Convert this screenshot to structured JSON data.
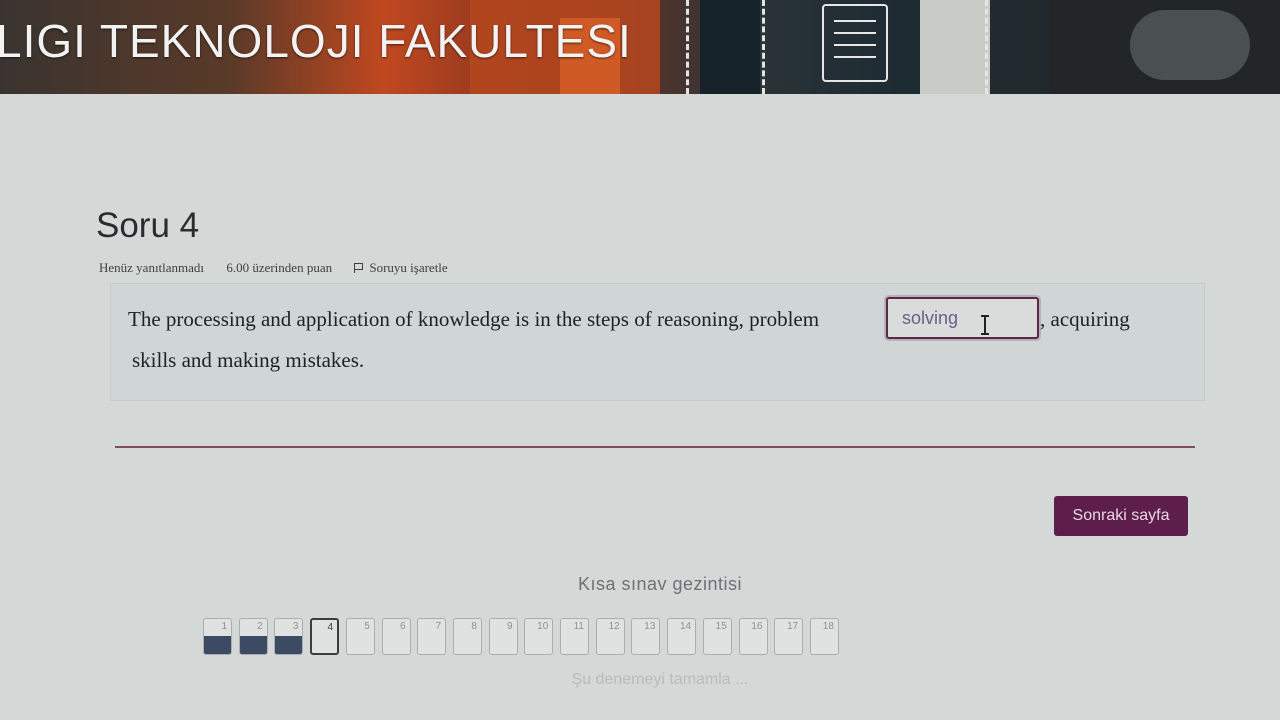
{
  "header": {
    "title": "LIGI TEKNOLOJI FAKULTESI"
  },
  "question": {
    "title": "Soru 4",
    "status": "Henüz yanıtlanmadı",
    "points": "6.00 üzerinden puan",
    "flag_label": "Soruyu işaretle",
    "text_before": "The processing and application of knowledge is in the steps of reasoning, problem",
    "answer_value": "solving",
    "text_after_line1": ", acquiring",
    "text_line2": "skills and making mistakes."
  },
  "actions": {
    "next_label": "Sonraki sayfa"
  },
  "quiz_nav": {
    "title": "Kısa sınav gezintisi",
    "buttons": [
      {
        "label": "1",
        "state": "answered"
      },
      {
        "label": "2",
        "state": "answered"
      },
      {
        "label": "3",
        "state": "answered"
      },
      {
        "label": "4",
        "state": "current"
      },
      {
        "label": "5",
        "state": "empty"
      },
      {
        "label": "6",
        "state": "empty"
      },
      {
        "label": "7",
        "state": "empty"
      },
      {
        "label": "8",
        "state": "empty"
      },
      {
        "label": "9",
        "state": "empty"
      },
      {
        "label": "10",
        "state": "empty"
      },
      {
        "label": "11",
        "state": "empty"
      },
      {
        "label": "12",
        "state": "empty"
      },
      {
        "label": "13",
        "state": "empty"
      },
      {
        "label": "14",
        "state": "empty"
      },
      {
        "label": "15",
        "state": "empty"
      },
      {
        "label": "16",
        "state": "empty"
      },
      {
        "label": "17",
        "state": "empty"
      },
      {
        "label": "18",
        "state": "empty"
      }
    ],
    "finish_label": "Şu denemeyi tamamla ..."
  },
  "colors": {
    "accent": "#5d1e4c",
    "answered": "#3c4b63"
  }
}
